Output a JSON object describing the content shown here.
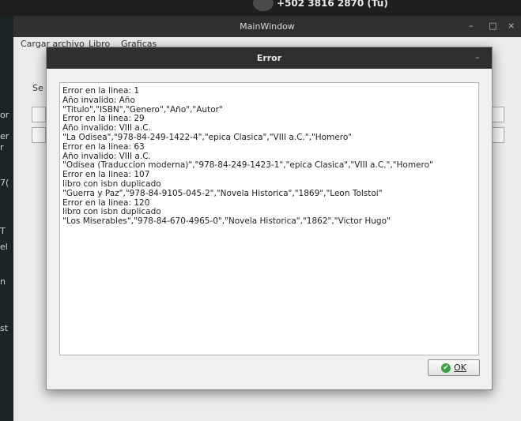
{
  "background": {
    "phone": "+502 3816 2870 (Tú)",
    "left_fragments": [
      "or",
      "er",
      "r",
      "7(",
      "T",
      "el",
      "n",
      "st"
    ]
  },
  "main_window": {
    "title": "MainWindow",
    "controls": {
      "minimize": "–",
      "maximize": "□",
      "close": "×"
    },
    "menu": [
      "Cargar archivo",
      "Libro",
      "Graficas"
    ],
    "partial_label": "Se"
  },
  "dialog": {
    "title": "Error",
    "minimize": "–",
    "message": "Error en la linea: 1\nAño invalido: Año\n\"Titulo\",\"ISBN\",\"Genero\",\"Año\",\"Autor\"\nError en la linea: 29\nAño invalido: VIII a.C.\n\"La Odisea\",\"978-84-249-1422-4\",\"epica Clasica\",\"VIII a.C.\",\"Homero\"\nError en la linea: 63\nAño invalido: VIII a.C.\n\"Odisea (Traduccion moderna)\",\"978-84-249-1423-1\",\"epica Clasica\",\"VIII a.C.\",\"Homero\"\nError en la linea: 107\nlibro con isbn duplicado\n\"Guerra y Paz\",\"978-84-9105-045-2\",\"Novela Historica\",\"1869\",\"Leon Tolstoi\"\nError en la linea: 120\nlibro con isbn duplicado\n\"Los Miserables\",\"978-84-670-4965-0\",\"Novela Historica\",\"1862\",\"Victor Hugo\"",
    "ok_label": "OK",
    "ok_icon": "check-circle-icon",
    "colors": {
      "ok_icon": "#3da045",
      "titlebar": "#2f2f2f"
    }
  }
}
